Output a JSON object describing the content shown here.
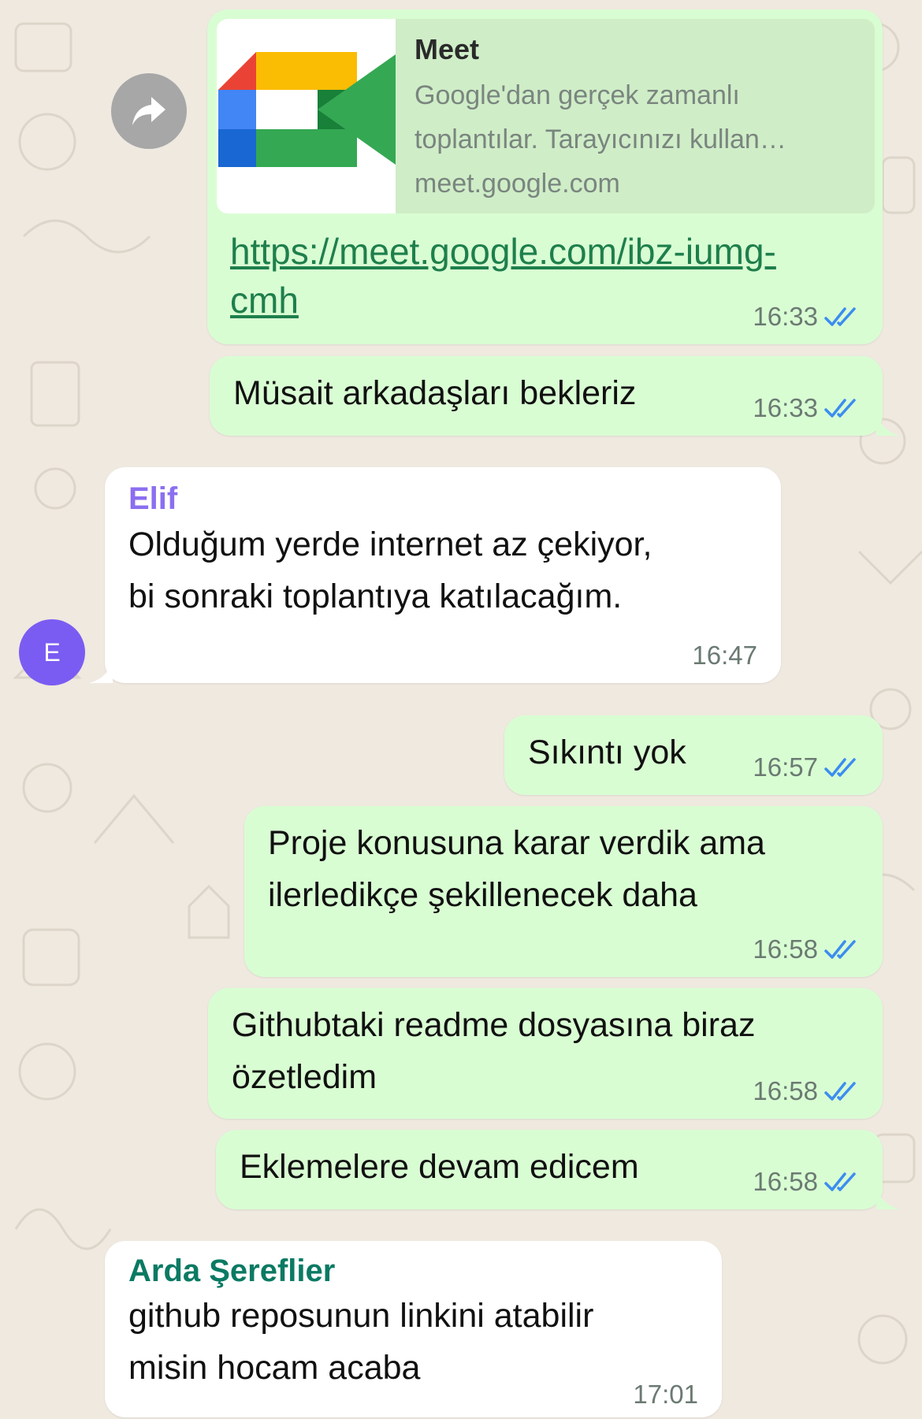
{
  "colors": {
    "wallpaper": "#efe9e0",
    "outgoing_bubble": "#d9fdd3",
    "incoming_bubble": "#ffffff",
    "link": "#1e7f4c",
    "read_ticks": "#3b8df0",
    "elif_name": "#8b6ff0",
    "arda_name": "#0b7a63",
    "avatar": "#7b5cf2"
  },
  "forward_button": {
    "icon": "share-arrow-icon"
  },
  "link_preview": {
    "title": "Meet",
    "description_line1": "Google'dan gerçek zamanlı",
    "description_line2": "toplantılar. Tarayıcınızı kullan…",
    "domain": "meet.google.com",
    "icon": "google-meet-logo",
    "url_line1": "https://meet.google.com/ibz-iumg-",
    "url_line2": "cmh",
    "time": "16:33"
  },
  "messages": [
    {
      "id": "m1",
      "direction": "outgoing",
      "text": "Müsait arkadaşları bekleriz",
      "time": "16:33"
    },
    {
      "id": "m2",
      "direction": "incoming",
      "sender": "Elif",
      "line1": "Olduğum yerde internet az çekiyor,",
      "line2": "bi sonraki toplantıya katılacağım.",
      "time": "16:47",
      "avatar_letter": "E"
    },
    {
      "id": "m3",
      "direction": "outgoing",
      "text": "Sıkıntı yok",
      "time": "16:57"
    },
    {
      "id": "m4",
      "direction": "outgoing",
      "line1": "Proje konusuna karar verdik ama",
      "line2": "ilerledikçe şekillenecek daha",
      "time": "16:58"
    },
    {
      "id": "m5",
      "direction": "outgoing",
      "line1": "Githubtaki readme dosyasına biraz",
      "line2": "özetledim",
      "time": "16:58"
    },
    {
      "id": "m6",
      "direction": "outgoing",
      "text": "Eklemelere devam edicem",
      "time": "16:58"
    },
    {
      "id": "m7",
      "direction": "incoming",
      "sender": "Arda Şereflier",
      "line1": "github reposunun linkini atabilir",
      "line2": "misin hocam acaba",
      "time": "17:01"
    }
  ]
}
